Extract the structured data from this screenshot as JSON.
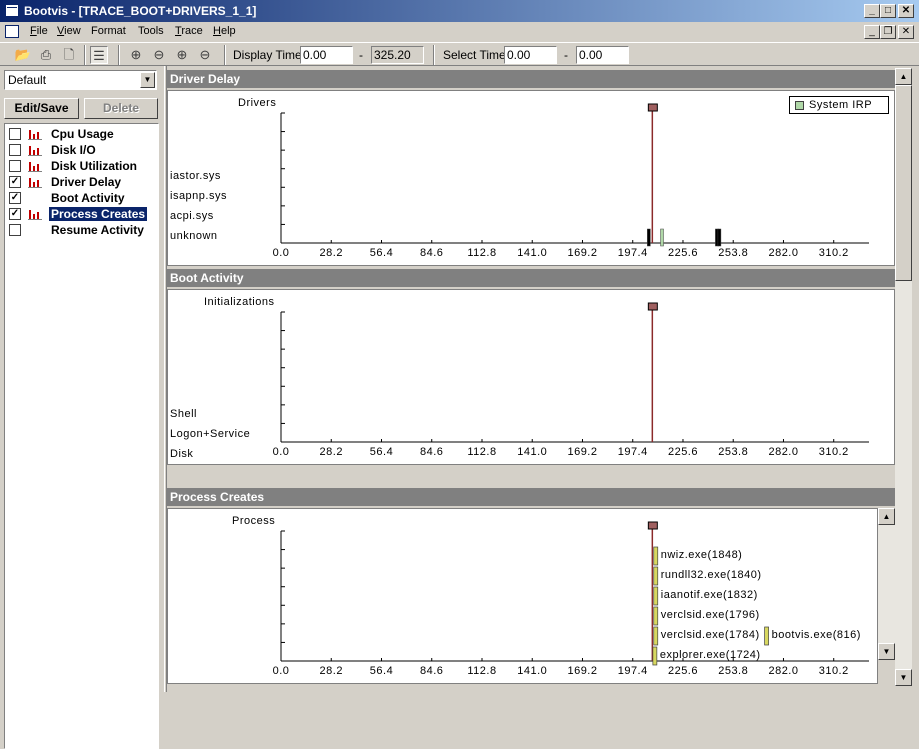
{
  "window": {
    "title": "Bootvis - [TRACE_BOOT+DRIVERS_1_1]"
  },
  "menu": [
    {
      "label": "File",
      "u": "F",
      "rest": "ile"
    },
    {
      "label": "View",
      "u": "V",
      "rest": "iew"
    },
    {
      "label": "Format",
      "u": "",
      "rest": "Format"
    },
    {
      "label": "Tools",
      "u": "",
      "rest": "Tools"
    },
    {
      "label": "Trace",
      "u": "T",
      "rest": "race"
    },
    {
      "label": "Help",
      "u": "H",
      "rest": "elp"
    }
  ],
  "toolbar": {
    "display_time_label": "Display Time",
    "display_time_start": "0.00",
    "display_time_sep": "-",
    "display_time_end": "325.20",
    "select_time_label": "Select Time",
    "select_time_start": "0.00",
    "select_time_sep": "-",
    "select_time_end": "0.00"
  },
  "sidebar": {
    "preset": "Default",
    "edit_save_label": "Edit/Save",
    "delete_label": "Delete",
    "charts": [
      {
        "label": "Cpu Usage",
        "checked": false,
        "icon": "bar-chart-icon",
        "selected": false
      },
      {
        "label": "Disk I/O",
        "checked": false,
        "icon": "bar-chart-icon",
        "selected": false
      },
      {
        "label": "Disk Utilization",
        "checked": false,
        "icon": "bar-chart-icon",
        "selected": false
      },
      {
        "label": "Driver Delay",
        "checked": true,
        "icon": "bar-chart-icon",
        "selected": false
      },
      {
        "label": "Boot Activity",
        "checked": true,
        "icon": "",
        "selected": false
      },
      {
        "label": "Process Creates",
        "checked": true,
        "icon": "bar-chart-icon",
        "selected": true
      },
      {
        "label": "Resume Activity",
        "checked": false,
        "icon": "",
        "selected": false
      }
    ]
  },
  "panels": {
    "driver_delay": {
      "title": "Driver Delay",
      "y_title": "Drivers",
      "rows": [
        "iastor.sys",
        "isapnp.sys",
        "acpi.sys",
        "unknown"
      ],
      "legend": "System IRP"
    },
    "boot_activity": {
      "title": "Boot Activity",
      "y_title": "Initializations",
      "rows": [
        "Shell",
        "Logon+Service",
        "Disk"
      ]
    },
    "process_creates": {
      "title": "Process Creates",
      "y_title": "Process",
      "rows": [
        "nwiz.exe(1848)",
        "rundll32.exe(1840)",
        "iaanotif.exe(1832)",
        "verclsid.exe(1796)",
        "verclsid.exe(1784)",
        "explorer.exe(1724)"
      ],
      "extra_label": "bootvis.exe(816)"
    }
  },
  "chart_data": [
    {
      "type": "bar",
      "title": "Driver Delay",
      "ylabel": "Drivers",
      "x_ticks": [
        0.0,
        28.2,
        56.4,
        84.6,
        112.8,
        141.0,
        169.2,
        197.4,
        225.6,
        253.8,
        282.0,
        310.2
      ],
      "tick_labels": [
        "0.0",
        "28.2",
        "56.4",
        "84.6",
        "112.8",
        "141.0",
        "169.2",
        "197.4",
        "225.6",
        "253.8",
        "282.0",
        "310.2"
      ],
      "xlim": [
        0,
        330
      ],
      "marker_time": 208.4,
      "series": [
        {
          "name": "System IRP",
          "color": "#b0d8a8",
          "events": [
            {
              "row": "unknown",
              "start": 213,
              "end": 214
            }
          ]
        },
        {
          "color": "#000000",
          "events": [
            {
              "row": "unknown",
              "start": 205.6,
              "end": 206.2
            },
            {
              "row": "unknown",
              "start": 243.8,
              "end": 244.4
            },
            {
              "row": "unknown",
              "start": 245.2,
              "end": 245.5
            }
          ]
        }
      ]
    },
    {
      "type": "bar",
      "title": "Boot Activity",
      "ylabel": "Initializations",
      "x_ticks": [
        0.0,
        28.2,
        56.4,
        84.6,
        112.8,
        141.0,
        169.2,
        197.4,
        225.6,
        253.8,
        282.0,
        310.2
      ],
      "tick_labels": [
        "0.0",
        "28.2",
        "56.4",
        "84.6",
        "112.8",
        "141.0",
        "169.2",
        "197.4",
        "225.6",
        "253.8",
        "282.0",
        "310.2"
      ],
      "xlim": [
        0,
        330
      ],
      "marker_time": 208.4
    },
    {
      "type": "bar",
      "title": "Process Creates",
      "ylabel": "Process",
      "x_ticks": [
        0.0,
        28.2,
        56.4,
        84.6,
        112.8,
        141.0,
        169.2,
        197.4,
        225.6,
        253.8,
        282.0,
        310.2
      ],
      "tick_labels": [
        "0.0",
        "28.2",
        "56.4",
        "84.6",
        "112.8",
        "141.0",
        "169.2",
        "197.4",
        "225.6",
        "253.8",
        "282.0",
        "310.2"
      ],
      "xlim": [
        0,
        330
      ],
      "marker_time": 208.4,
      "color": "#d8d860",
      "events": [
        {
          "label": "nwiz.exe(1848)",
          "time": 209.2
        },
        {
          "label": "rundll32.exe(1840)",
          "time": 209.2
        },
        {
          "label": "iaanotif.exe(1832)",
          "time": 209.2
        },
        {
          "label": "verclsid.exe(1796)",
          "time": 209.2
        },
        {
          "label": "verclsid.exe(1784)",
          "time": 209.2
        },
        {
          "label": "bootvis.exe(816)",
          "time": 271.4
        },
        {
          "label": "explorer.exe(1724)",
          "time": 208.7
        }
      ]
    }
  ]
}
